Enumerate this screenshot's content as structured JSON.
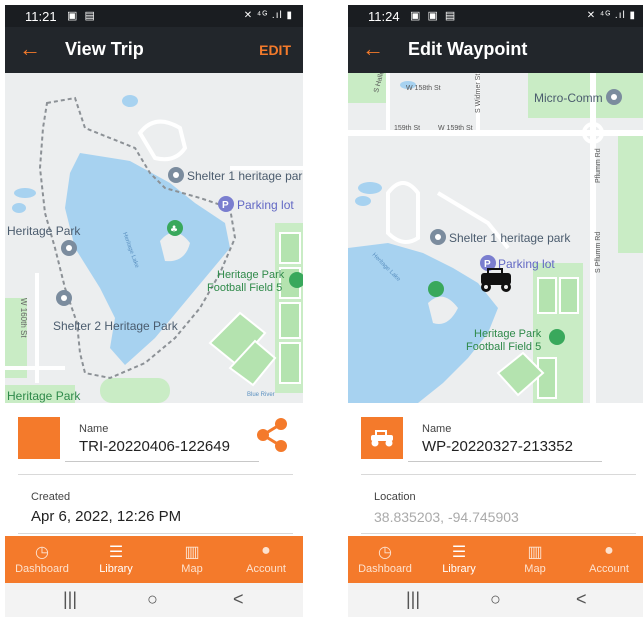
{
  "colors": {
    "accent": "#f47a2b",
    "appbar": "#22262b",
    "water": "#a7d2f0",
    "park": "#c9ecc5"
  },
  "phones": [
    {
      "status": {
        "time": "11:21",
        "left_icons": "▣ ▤",
        "right_icons": "✕ ⁴ᴳ .ıl ▮"
      },
      "appbar": {
        "back": "←",
        "title": "View Trip",
        "action": "EDIT"
      },
      "map_labels": {
        "shelter1": "Shelter 1 heritage park",
        "parking": "Parking lot",
        "heritage_park": "Heritage Park",
        "football": "Heritage Park\nFootball Field 5",
        "shelter2": "Shelter 2 Heritage Park",
        "lake": "Heritage Lake",
        "river": "Blue River",
        "street": "W 160th St",
        "heritage_bottom": "Heritage Park"
      },
      "card": {
        "name_label": "Name",
        "name_value": "TRI-20220406-122649",
        "second_label": "Created",
        "second_value": "Apr 6, 2022, 12:26 PM"
      },
      "nav": [
        {
          "icon": "speedometer-icon",
          "glyph": "◷",
          "label": "Dashboard",
          "active": false
        },
        {
          "icon": "list-icon",
          "glyph": "☰",
          "label": "Library",
          "active": true
        },
        {
          "icon": "map-icon",
          "glyph": "▥",
          "label": "Map",
          "active": false
        },
        {
          "icon": "person-icon",
          "glyph": "●",
          "label": "Account",
          "active": false
        }
      ],
      "sys": {
        "recents": "|||",
        "home": "○",
        "back": "<"
      }
    },
    {
      "status": {
        "time": "11:24",
        "left_icons": "▣ ▣ ▤",
        "right_icons": "✕ ⁴ᴳ .ıl ▮"
      },
      "appbar": {
        "back": "←",
        "title": "Edit Waypoint",
        "action": ""
      },
      "map_labels": {
        "hallet": "S Hallet St",
        "st158": "W 158th St",
        "widmer": "S Widmer St",
        "microcomm": "Micro-Comm",
        "st159": "159th St",
        "w159": "W 159th St",
        "pflumm": "Pflumm Rd",
        "pflumm2": "S Pflumm Rd",
        "shelter1": "Shelter 1 heritage park",
        "parking": "Parking lot",
        "football": "Heritage Park\nFootball Field 5",
        "lake": "Heritage Lake"
      },
      "card": {
        "name_label": "Name",
        "name_value": "WP-20220327-213352",
        "second_label": "Location",
        "second_value": "38.835203, -94.745903"
      },
      "nav": [
        {
          "icon": "speedometer-icon",
          "glyph": "◷",
          "label": "Dashboard",
          "active": false
        },
        {
          "icon": "list-icon",
          "glyph": "☰",
          "label": "Library",
          "active": true
        },
        {
          "icon": "map-icon",
          "glyph": "▥",
          "label": "Map",
          "active": false
        },
        {
          "icon": "person-icon",
          "glyph": "●",
          "label": "Account",
          "active": false
        }
      ],
      "sys": {
        "recents": "|||",
        "home": "○",
        "back": "<"
      }
    }
  ]
}
